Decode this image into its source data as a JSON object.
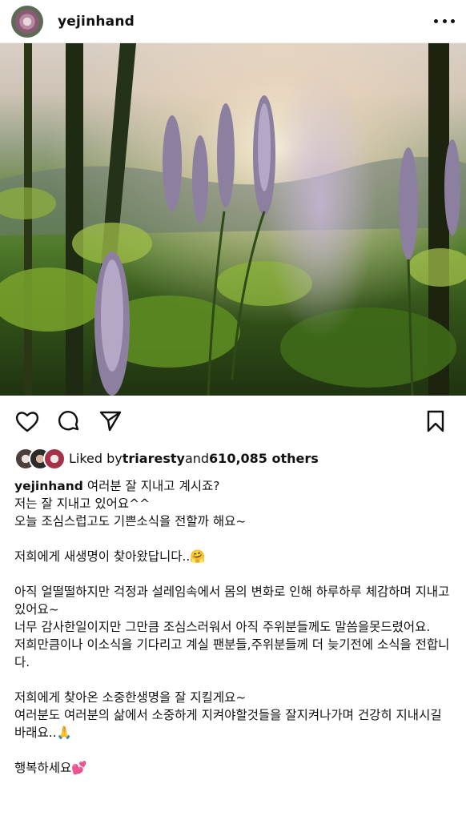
{
  "post": {
    "username": "yejinhand",
    "liked_by_prefix": "Liked by ",
    "liked_by_user": "triaresty",
    "liked_by_and": " and ",
    "liked_by_count": "610,085 others",
    "caption_user": "yejinhand",
    "caption_lines": [
      "여러분 잘 지내고 계시죠?",
      "저는 잘 지내고 있어요^^",
      "오늘 조심스럽고도 기쁜소식을 전할까 해요~",
      "",
      "저희에게 새생명이 찾아왔답니다..🤗",
      "",
      "아직 얼떨떨하지만 걱정과 설레임속에서 몸의 변화로 인해 하루하루 체감하며 지내고있어요~",
      "너무 감사한일이지만 그만큼 조심스러워서 아직 주위분들께도 말씀을못드렸어요.",
      "저희만큼이나 이소식을 기다리고 계실 팬분들,주위분들께 더 늦기전에 소식을 전합니다.",
      "",
      "저희에게 찾아온 소중한생명을 잘 지킬게요~",
      "여러분도 여러분의 삶에서 소중하게 지켜야할것들을 잘지켜나가며 건강히 지내시길 바래요..🙏",
      "",
      "행복하세요💕"
    ]
  },
  "icons": {
    "more": "more-icon",
    "like": "heart-icon",
    "comment": "comment-icon",
    "share": "send-icon",
    "save": "bookmark-icon"
  }
}
